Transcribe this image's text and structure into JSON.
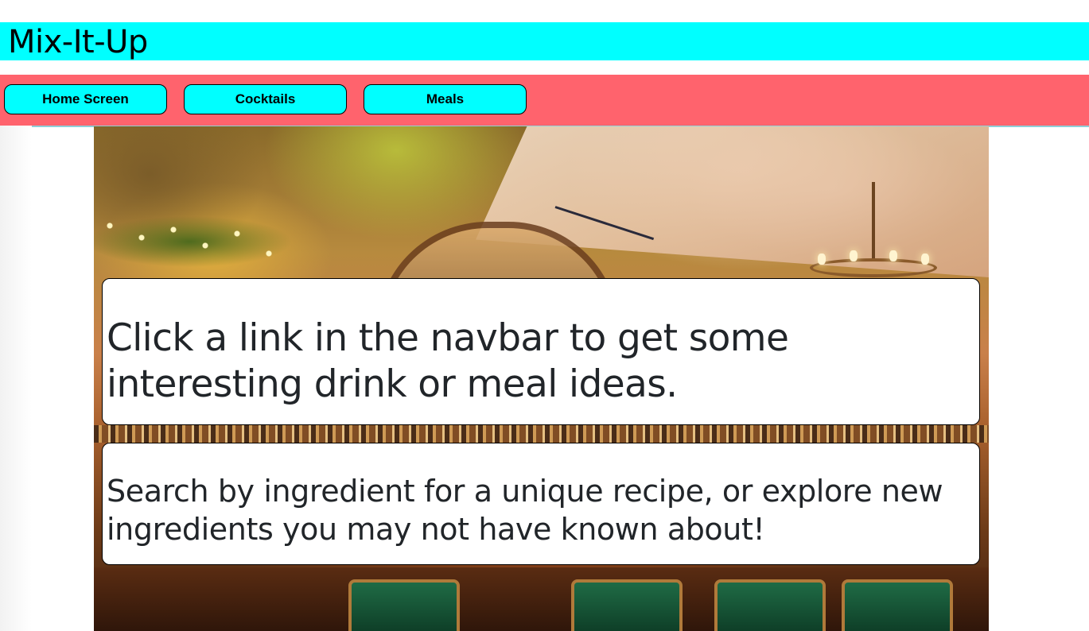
{
  "header": {
    "title": "Mix-It-Up"
  },
  "navbar": {
    "items": [
      {
        "label": "Home Screen"
      },
      {
        "label": "Cocktails"
      },
      {
        "label": "Meals"
      }
    ]
  },
  "hero": {
    "image_subject": "restaurant-bar-interior",
    "headline": "Click a link in the navbar to get some interesting drink or meal ideas.",
    "subtext": "Search by ingredient for a unique recipe, or explore new ingredients you may not have known about!"
  },
  "colors": {
    "header_bg": "#00ffff",
    "navbar_bg": "#ff636d",
    "button_bg": "#00ffff",
    "card_bg": "#ffffff",
    "text": "#212529"
  }
}
